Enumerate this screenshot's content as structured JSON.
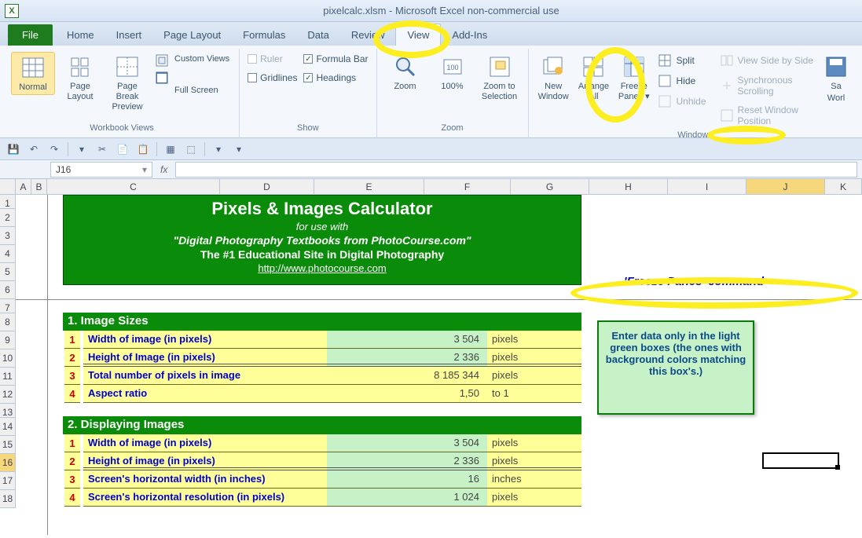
{
  "app": {
    "title": "pixelcalc.xlsm  -  Microsoft Excel non-commercial use"
  },
  "tabs": {
    "file": "File",
    "items": [
      "Home",
      "Insert",
      "Page Layout",
      "Formulas",
      "Data",
      "Review",
      "View",
      "Add-Ins"
    ],
    "active": "View"
  },
  "ribbon": {
    "workbook_views": {
      "label": "Workbook Views",
      "normal": "Normal",
      "page_layout": "Page Layout",
      "page_break": "Page Break Preview",
      "custom": "Custom Views",
      "full": "Full Screen"
    },
    "show": {
      "label": "Show",
      "ruler": "Ruler",
      "gridlines": "Gridlines",
      "formula_bar": "Formula Bar",
      "headings": "Headings"
    },
    "zoom": {
      "label": "Zoom",
      "zoom": "Zoom",
      "hundred": "100%",
      "to_sel": "Zoom to Selection"
    },
    "window": {
      "label": "Window",
      "new": "New Window",
      "arrange": "Arrange All",
      "freeze": "Freeze Panes",
      "split": "Split",
      "hide": "Hide",
      "unhide": "Unhide",
      "side": "View Side by Side",
      "sync": "Synchronous Scrolling",
      "reset": "Reset Window Position"
    },
    "macros": {
      "save": "Sa",
      "work": "Worl"
    }
  },
  "fx": {
    "name": "J16",
    "fxglyph": "fx"
  },
  "cols": [
    "A",
    "B",
    "C",
    "D",
    "E",
    "F",
    "G",
    "H",
    "I",
    "J",
    "K"
  ],
  "rows": [
    "1",
    "2",
    "3",
    "4",
    "5",
    "6",
    "7",
    "8",
    "9",
    "10",
    "11",
    "12",
    "13",
    "14",
    "15",
    "16",
    "17",
    "18"
  ],
  "banner": {
    "t1": "Pixels & Images Calculator",
    "t2": "for use with",
    "t3": "\"Digital Photography Textbooks from PhotoCourse.com\"",
    "t4": "The #1 Educational Site in Digital Photography",
    "t5": "http://www.photocourse.com"
  },
  "sec1": {
    "title": "1. Image Sizes",
    "rows": [
      {
        "n": "1",
        "d": "Width of image (in pixels)",
        "v": "3 504",
        "u": "pixels",
        "green": true
      },
      {
        "n": "2",
        "d": "Height of Image (in pixels)",
        "v": "2 336",
        "u": "pixels",
        "green": true,
        "dbl": true
      },
      {
        "n": "3",
        "d": "Total number of pixels in image",
        "v": "8 185 344",
        "u": "pixels"
      },
      {
        "n": "4",
        "d": "Aspect ratio",
        "v": "1,50",
        "u": "to 1"
      }
    ]
  },
  "sec2": {
    "title": "2. Displaying Images",
    "rows": [
      {
        "n": "1",
        "d": "Width of image (in pixels)",
        "v": "3 504",
        "u": "pixels",
        "green": true
      },
      {
        "n": "2",
        "d": "Height of image (in pixels)",
        "v": "2 336",
        "u": "pixels",
        "green": true,
        "dbl": true
      },
      {
        "n": "3",
        "d": "Screen's horizontal width (in inches)",
        "v": "16",
        "u": "inches",
        "green": true
      },
      {
        "n": "4",
        "d": "Screen's horizontal resolution (in pixels)",
        "v": "1 024",
        "u": "pixels",
        "green": true
      }
    ]
  },
  "annot": {
    "freeze": "'Freeze Panes' command",
    "info": "Enter data only in the light green boxes (the ones with background colors matching this box's.)"
  }
}
